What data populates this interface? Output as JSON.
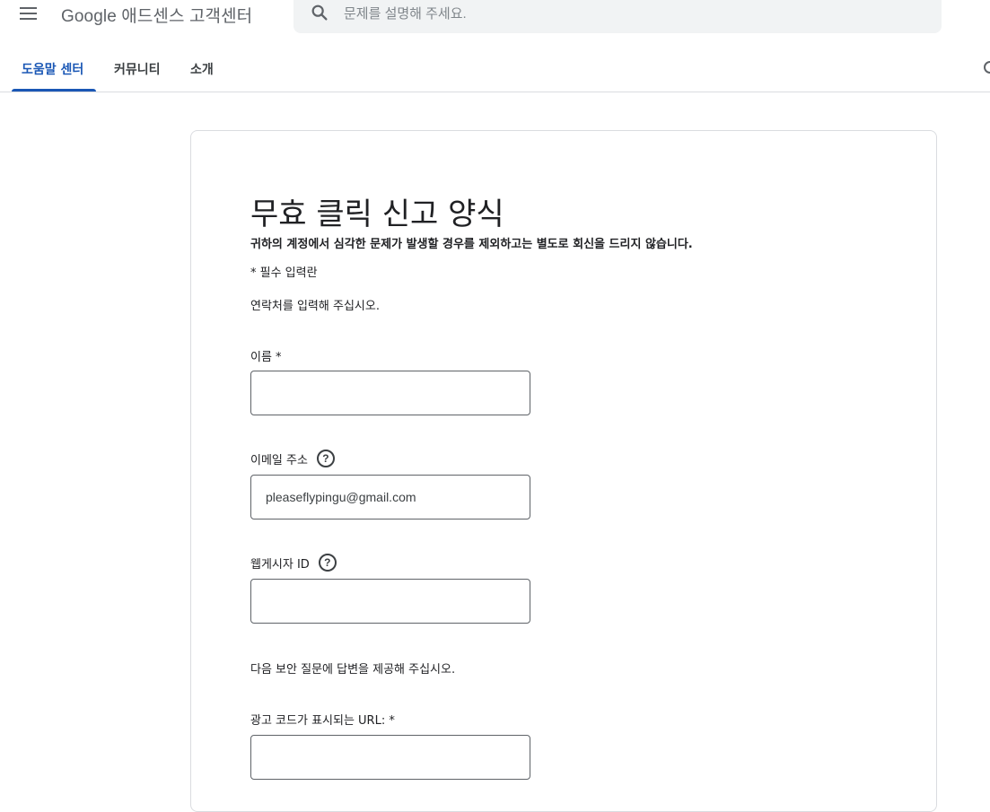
{
  "header": {
    "app_title": "Google 애드센스 고객센터",
    "search_placeholder": "문제를 설명해 주세요."
  },
  "tabs": [
    {
      "label": "도움말 센터",
      "active": true
    },
    {
      "label": "커뮤니티",
      "active": false
    },
    {
      "label": "소개",
      "active": false
    }
  ],
  "form": {
    "title": "무효 클릭 신고 양식",
    "notice": "귀하의 계정에서 심각한 문제가 발생할 경우를 제외하고는 별도로 회신을 드리지 않습니다.",
    "required_note": "* 필수 입력란",
    "contact_intro": "연락처를 입력해 주십시오.",
    "fields": {
      "name": {
        "label": "이름 *",
        "value": ""
      },
      "email": {
        "label": "이메일 주소",
        "value": "pleaseflypingu@gmail.com"
      },
      "publisher_id": {
        "label": "웹게시자 ID",
        "value": ""
      }
    },
    "security_intro": "다음 보안 질문에 답변을 제공해 주십시오.",
    "ad_url": {
      "label": "광고 코드가 표시되는 URL: *",
      "value": ""
    }
  },
  "colors": {
    "accent": "#1a57b5",
    "border": "#dadce0",
    "input_border": "#5f6368"
  },
  "icons": {
    "menu": "hamburger-menu-icon",
    "search": "search-icon",
    "help": "help-circle-icon"
  }
}
